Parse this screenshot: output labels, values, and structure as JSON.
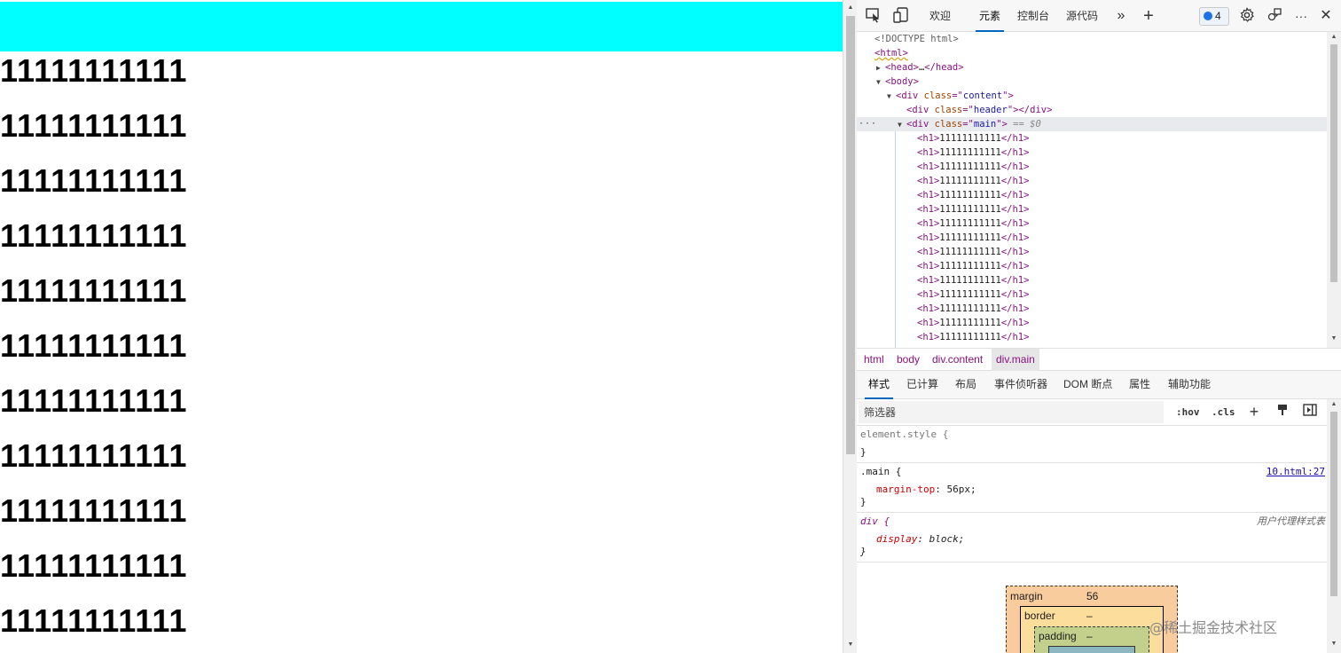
{
  "page": {
    "headings": [
      "11111111111",
      "11111111111",
      "11111111111",
      "11111111111",
      "11111111111",
      "11111111111",
      "11111111111",
      "11111111111",
      "11111111111",
      "11111111111",
      "11111111111"
    ]
  },
  "devtools": {
    "tabs": {
      "welcome": "欢迎",
      "elements": "元素",
      "console": "控制台",
      "sources": "源代码"
    },
    "more_tabs_glyph": "»",
    "add_tab_glyph": "+",
    "issues_count": "4",
    "dom": {
      "doctype": "<!DOCTYPE html>",
      "html_open": "<html>",
      "head_tag_open": "<head>",
      "head_ellipsis": "…",
      "head_tag_close": "</head>",
      "body_tag": "<body>",
      "div_open": "<div",
      "attr_class": "class",
      "eq_quote": "=\"",
      "quote_gt": "\">",
      "div_close": "</div>",
      "content_class": "content",
      "header_class": "header",
      "main_class": "main",
      "selected_marker": "== $0",
      "dots": "···",
      "h1_open": "<h1>",
      "h1_close": "</h1>",
      "h1_text": "11111111111"
    },
    "breadcrumbs": [
      "html",
      "body",
      "div.content",
      "div.main"
    ],
    "subtabs": [
      "样式",
      "已计算",
      "布局",
      "事件侦听器",
      "DOM 断点",
      "属性",
      "辅助功能"
    ],
    "filter": {
      "placeholder": "筛选器",
      "hov": ":hov",
      "cls": ".cls"
    },
    "styles": {
      "element_style": "element.style {",
      "close_brace": "}",
      "main_selector": ".main {",
      "main_source": "10.html:27",
      "main_prop": "margin-top",
      "main_value": "56px;",
      "div_selector": "div {",
      "div_source": "用户代理样式表",
      "div_prop": "display",
      "div_value": "block;",
      "colon": ":"
    },
    "box_model": {
      "margin_label": "margin",
      "margin_value": "56",
      "border_label": "border",
      "border_value": "–",
      "padding_label": "padding",
      "padding_value": "–"
    }
  },
  "watermark": "@稀土掘金技术社区",
  "colors": {
    "header_bg": "#00ffff",
    "accent": "#0067c0"
  }
}
